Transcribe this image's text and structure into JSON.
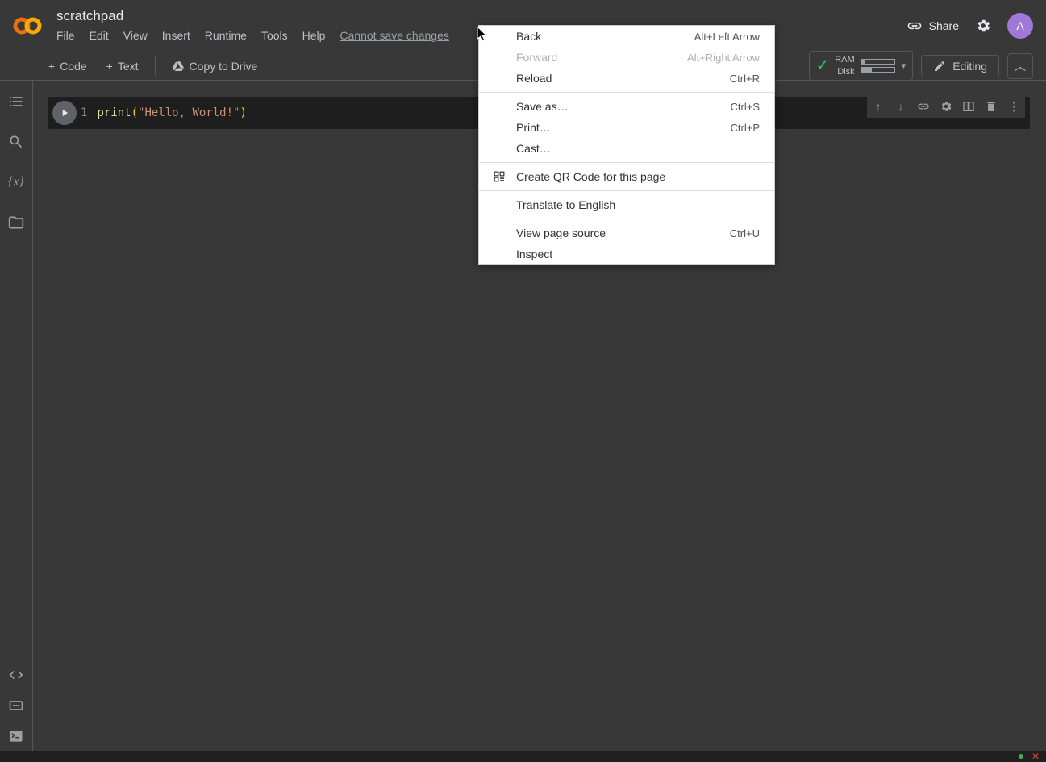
{
  "header": {
    "title": "scratchpad",
    "menus": [
      "File",
      "Edit",
      "View",
      "Insert",
      "Runtime",
      "Tools",
      "Help"
    ],
    "cannot_save": "Cannot save changes",
    "share": "Share",
    "avatar_letter": "A"
  },
  "toolbar": {
    "code": "Code",
    "text": "Text",
    "copy_drive": "Copy to Drive",
    "ram": "RAM",
    "disk": "Disk",
    "editing": "Editing"
  },
  "cell": {
    "line_num": "1",
    "func": "print",
    "open_paren": "(",
    "string": "\"Hello, World!\"",
    "close_paren": ")"
  },
  "context_menu": {
    "items": [
      {
        "label": "Back",
        "shortcut": "Alt+Left Arrow"
      },
      {
        "label": "Forward",
        "shortcut": "Alt+Right Arrow",
        "disabled": true
      },
      {
        "label": "Reload",
        "shortcut": "Ctrl+R"
      },
      {
        "sep": true
      },
      {
        "label": "Save as…",
        "shortcut": "Ctrl+S"
      },
      {
        "label": "Print…",
        "shortcut": "Ctrl+P"
      },
      {
        "label": "Cast…",
        "shortcut": ""
      },
      {
        "sep": true
      },
      {
        "label": "Create QR Code for this page",
        "shortcut": "",
        "icon": "qr"
      },
      {
        "sep": true
      },
      {
        "label": "Translate to English",
        "shortcut": ""
      },
      {
        "sep": true
      },
      {
        "label": "View page source",
        "shortcut": "Ctrl+U"
      },
      {
        "label": "Inspect",
        "shortcut": ""
      }
    ]
  },
  "resource_bars": {
    "ram_pct": 8,
    "disk_pct": 30
  }
}
